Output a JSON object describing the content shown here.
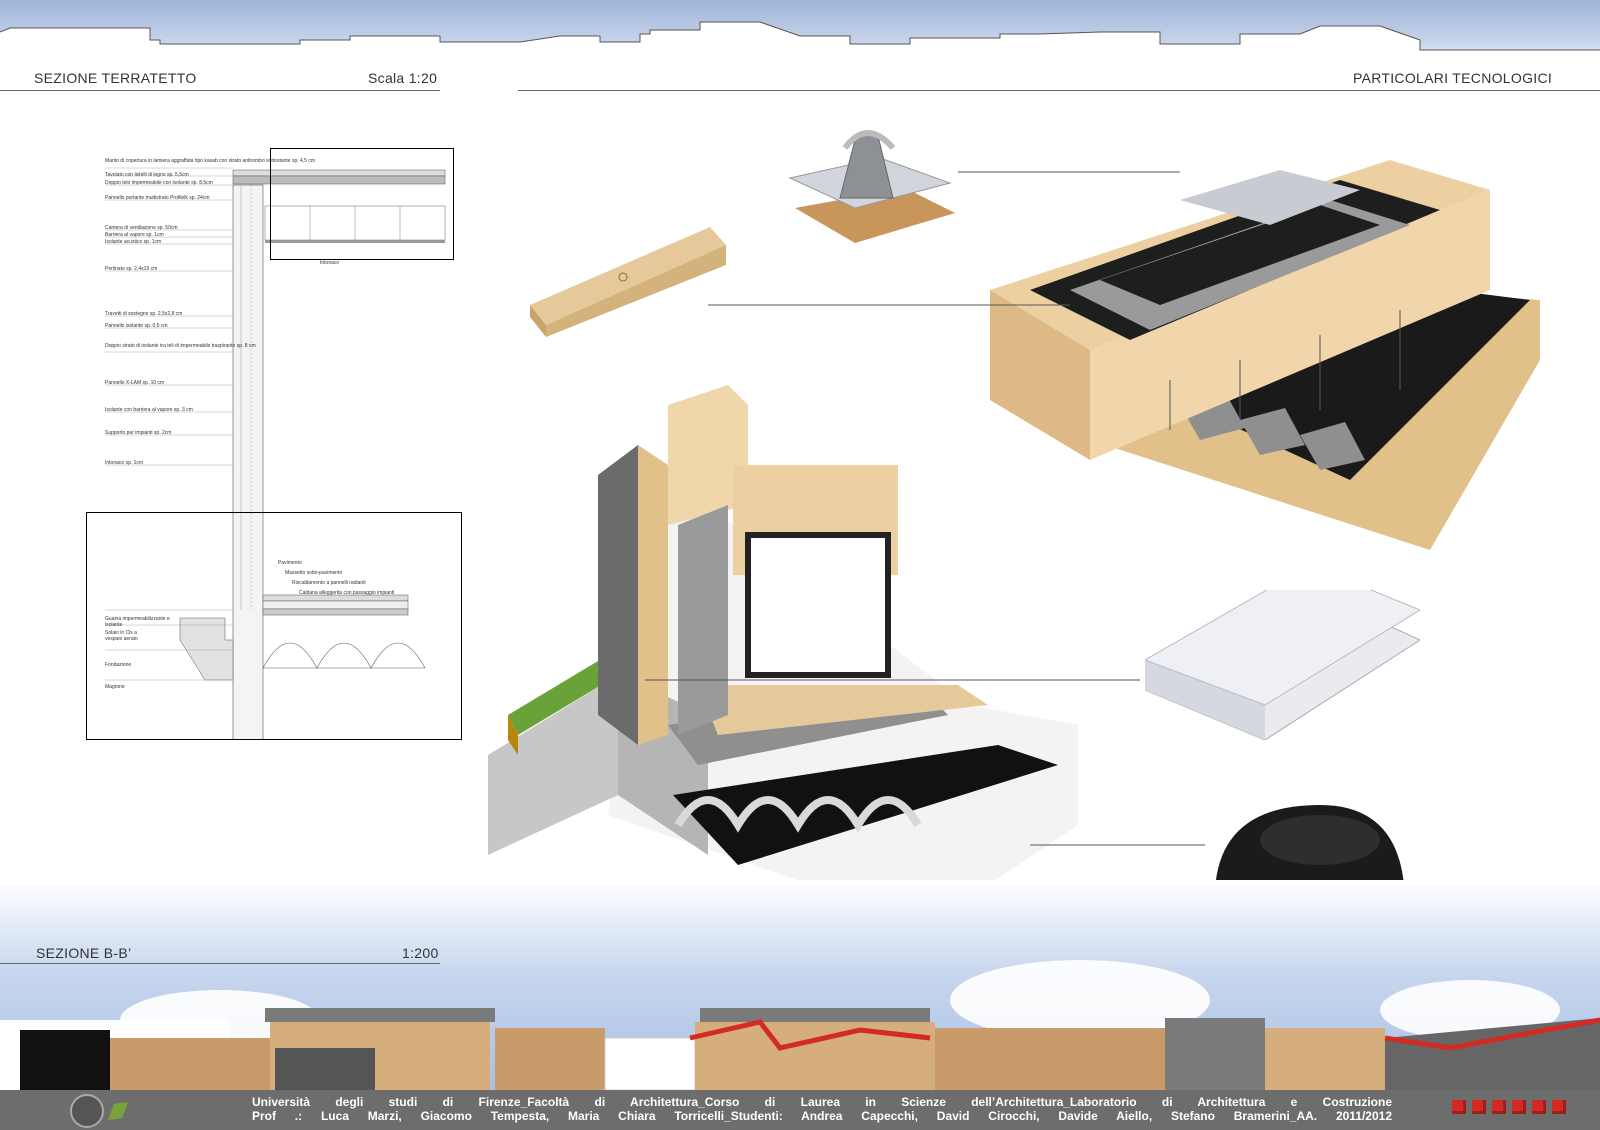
{
  "header": {
    "left_title": "SEZIONE TERRATETTO",
    "left_scale": "Scala 1:20",
    "right_title": "PARTICOLARI TECNOLOGICI"
  },
  "section": {
    "title": "SEZIONE B-B’",
    "scale": "1:200"
  },
  "drawing_notes": [
    "Manto di copertura in lamiera aggraffata tipo kasab con strato antirombo sottostante sp. 4,5 cm",
    "Tavolato con listelli di legno sp. 5,5cm",
    "Doppio telo impermeabile con isolante sp. 8,5cm",
    "Pannello portante multistrato Profilelk sp. 24cm",
    "Camera di ventilazione sp. 50cm",
    "Barriera al vapore sp. 1cm",
    "Isolante acustico sp. 1cm",
    "Perlinato sp. 2,4x19 cm",
    "Travetti di sostegno sp. 2,5x2,8 cm",
    "Pannello isolante sp. 0,5 cm",
    "Doppio strato di isolante tra teli di impermeabile traspirante sp. 8 cm",
    "Pannello X-LAM sp. 10 cm",
    "Isolante con barriera al vapore sp. 3 cm",
    "Supporto per impianti sp. 2cm",
    "Intonaco sp. 1cm"
  ],
  "drawing_notes_top": {
    "intonaco": "Intonaco"
  },
  "floor_notes": [
    "Pavimento",
    "Massetto sotto-pavimento",
    "Riscaldamento a pannelli radianti",
    "Caldana alleggerita con passaggio impianti"
  ],
  "foundation_notes": [
    "Guaina impermeabilizzante e isolante",
    "Solaio in Cls a vespaio aerato",
    "Fondazione",
    "Magrone"
  ],
  "footer": {
    "line1": "Università degli studi di Firenze_Facoltà di Architettura_Corso di Laurea in Scienze dell’Architettura_Laboratorio di Architettura e Costruzione",
    "line2": "Prof .: Luca Marzi, Giacomo Tempesta, Maria Chiara Torricelli_Studenti: Andrea Capecchi, David Cirocchi, Davide Aiello, Stefano Bramerini_AA. 2011/2012"
  },
  "colors": {
    "wood": "#e6c99a",
    "insulation": "#9a9a9a",
    "membrane": "#1e1e1e",
    "metal": "#c8ccd2",
    "accent_red": "#d42a24"
  }
}
